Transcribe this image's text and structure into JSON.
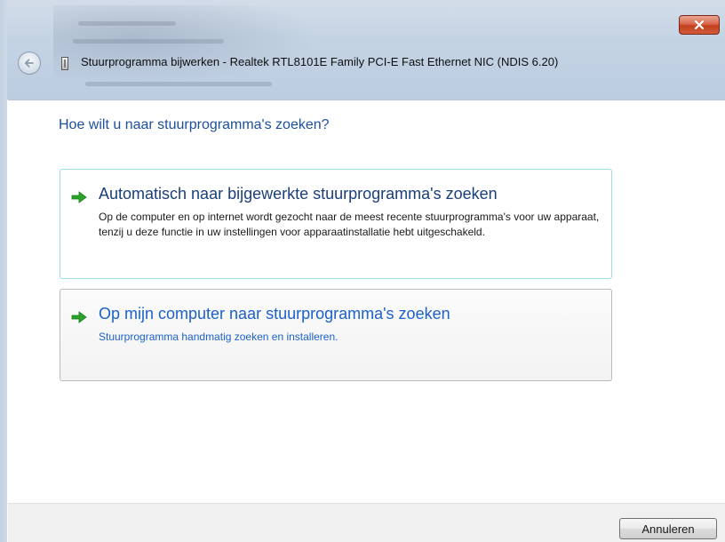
{
  "window": {
    "title": "Stuurprogramma bijwerken - Realtek RTL8101E Family PCI-E Fast Ethernet NIC (NDIS 6.20)",
    "close_icon": "close-icon",
    "back_icon": "back-arrow-icon",
    "title_icon": "device-icon"
  },
  "main": {
    "heading": "Hoe wilt u naar stuurprogramma's zoeken?",
    "options": [
      {
        "title": "Automatisch naar bijgewerkte stuurprogramma's zoeken",
        "description": "Op de computer en op internet wordt gezocht naar de meest recente stuurprogramma's voor uw apparaat, tenzij u deze functie in uw instellingen voor apparaatinstallatie hebt uitgeschakeld.",
        "icon": "green-arrow-icon"
      },
      {
        "title": "Op mijn computer naar stuurprogramma's zoeken",
        "description": "Stuurprogramma handmatig zoeken en installeren.",
        "icon": "green-arrow-icon"
      }
    ]
  },
  "footer": {
    "cancel_label": "Annuleren"
  },
  "colors": {
    "heading": "#1c4f9c",
    "link": "#1b61c9",
    "arrow": "#2aa52a",
    "close_button": "#c3401f"
  }
}
